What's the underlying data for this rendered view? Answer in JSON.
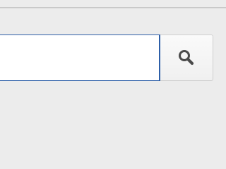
{
  "search": {
    "value": "",
    "placeholder": "",
    "button_icon": "search-icon",
    "focus_color": "#2d5fa8"
  }
}
